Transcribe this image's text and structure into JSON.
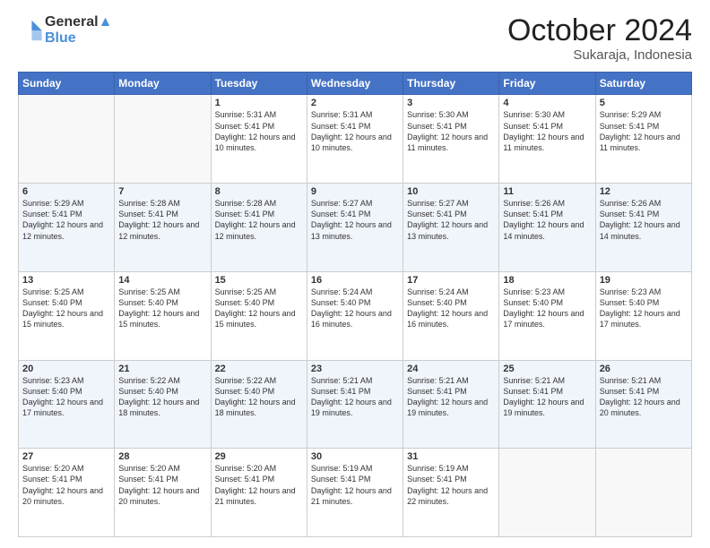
{
  "header": {
    "logo_line1": "General",
    "logo_line2": "Blue",
    "month": "October 2024",
    "location": "Sukaraja, Indonesia"
  },
  "weekdays": [
    "Sunday",
    "Monday",
    "Tuesday",
    "Wednesday",
    "Thursday",
    "Friday",
    "Saturday"
  ],
  "weeks": [
    [
      {
        "day": "",
        "info": ""
      },
      {
        "day": "",
        "info": ""
      },
      {
        "day": "1",
        "info": "Sunrise: 5:31 AM\nSunset: 5:41 PM\nDaylight: 12 hours and 10 minutes."
      },
      {
        "day": "2",
        "info": "Sunrise: 5:31 AM\nSunset: 5:41 PM\nDaylight: 12 hours and 10 minutes."
      },
      {
        "day": "3",
        "info": "Sunrise: 5:30 AM\nSunset: 5:41 PM\nDaylight: 12 hours and 11 minutes."
      },
      {
        "day": "4",
        "info": "Sunrise: 5:30 AM\nSunset: 5:41 PM\nDaylight: 12 hours and 11 minutes."
      },
      {
        "day": "5",
        "info": "Sunrise: 5:29 AM\nSunset: 5:41 PM\nDaylight: 12 hours and 11 minutes."
      }
    ],
    [
      {
        "day": "6",
        "info": "Sunrise: 5:29 AM\nSunset: 5:41 PM\nDaylight: 12 hours and 12 minutes."
      },
      {
        "day": "7",
        "info": "Sunrise: 5:28 AM\nSunset: 5:41 PM\nDaylight: 12 hours and 12 minutes."
      },
      {
        "day": "8",
        "info": "Sunrise: 5:28 AM\nSunset: 5:41 PM\nDaylight: 12 hours and 12 minutes."
      },
      {
        "day": "9",
        "info": "Sunrise: 5:27 AM\nSunset: 5:41 PM\nDaylight: 12 hours and 13 minutes."
      },
      {
        "day": "10",
        "info": "Sunrise: 5:27 AM\nSunset: 5:41 PM\nDaylight: 12 hours and 13 minutes."
      },
      {
        "day": "11",
        "info": "Sunrise: 5:26 AM\nSunset: 5:41 PM\nDaylight: 12 hours and 14 minutes."
      },
      {
        "day": "12",
        "info": "Sunrise: 5:26 AM\nSunset: 5:41 PM\nDaylight: 12 hours and 14 minutes."
      }
    ],
    [
      {
        "day": "13",
        "info": "Sunrise: 5:25 AM\nSunset: 5:40 PM\nDaylight: 12 hours and 15 minutes."
      },
      {
        "day": "14",
        "info": "Sunrise: 5:25 AM\nSunset: 5:40 PM\nDaylight: 12 hours and 15 minutes."
      },
      {
        "day": "15",
        "info": "Sunrise: 5:25 AM\nSunset: 5:40 PM\nDaylight: 12 hours and 15 minutes."
      },
      {
        "day": "16",
        "info": "Sunrise: 5:24 AM\nSunset: 5:40 PM\nDaylight: 12 hours and 16 minutes."
      },
      {
        "day": "17",
        "info": "Sunrise: 5:24 AM\nSunset: 5:40 PM\nDaylight: 12 hours and 16 minutes."
      },
      {
        "day": "18",
        "info": "Sunrise: 5:23 AM\nSunset: 5:40 PM\nDaylight: 12 hours and 17 minutes."
      },
      {
        "day": "19",
        "info": "Sunrise: 5:23 AM\nSunset: 5:40 PM\nDaylight: 12 hours and 17 minutes."
      }
    ],
    [
      {
        "day": "20",
        "info": "Sunrise: 5:23 AM\nSunset: 5:40 PM\nDaylight: 12 hours and 17 minutes."
      },
      {
        "day": "21",
        "info": "Sunrise: 5:22 AM\nSunset: 5:40 PM\nDaylight: 12 hours and 18 minutes."
      },
      {
        "day": "22",
        "info": "Sunrise: 5:22 AM\nSunset: 5:40 PM\nDaylight: 12 hours and 18 minutes."
      },
      {
        "day": "23",
        "info": "Sunrise: 5:21 AM\nSunset: 5:41 PM\nDaylight: 12 hours and 19 minutes."
      },
      {
        "day": "24",
        "info": "Sunrise: 5:21 AM\nSunset: 5:41 PM\nDaylight: 12 hours and 19 minutes."
      },
      {
        "day": "25",
        "info": "Sunrise: 5:21 AM\nSunset: 5:41 PM\nDaylight: 12 hours and 19 minutes."
      },
      {
        "day": "26",
        "info": "Sunrise: 5:21 AM\nSunset: 5:41 PM\nDaylight: 12 hours and 20 minutes."
      }
    ],
    [
      {
        "day": "27",
        "info": "Sunrise: 5:20 AM\nSunset: 5:41 PM\nDaylight: 12 hours and 20 minutes."
      },
      {
        "day": "28",
        "info": "Sunrise: 5:20 AM\nSunset: 5:41 PM\nDaylight: 12 hours and 20 minutes."
      },
      {
        "day": "29",
        "info": "Sunrise: 5:20 AM\nSunset: 5:41 PM\nDaylight: 12 hours and 21 minutes."
      },
      {
        "day": "30",
        "info": "Sunrise: 5:19 AM\nSunset: 5:41 PM\nDaylight: 12 hours and 21 minutes."
      },
      {
        "day": "31",
        "info": "Sunrise: 5:19 AM\nSunset: 5:41 PM\nDaylight: 12 hours and 22 minutes."
      },
      {
        "day": "",
        "info": ""
      },
      {
        "day": "",
        "info": ""
      }
    ]
  ]
}
